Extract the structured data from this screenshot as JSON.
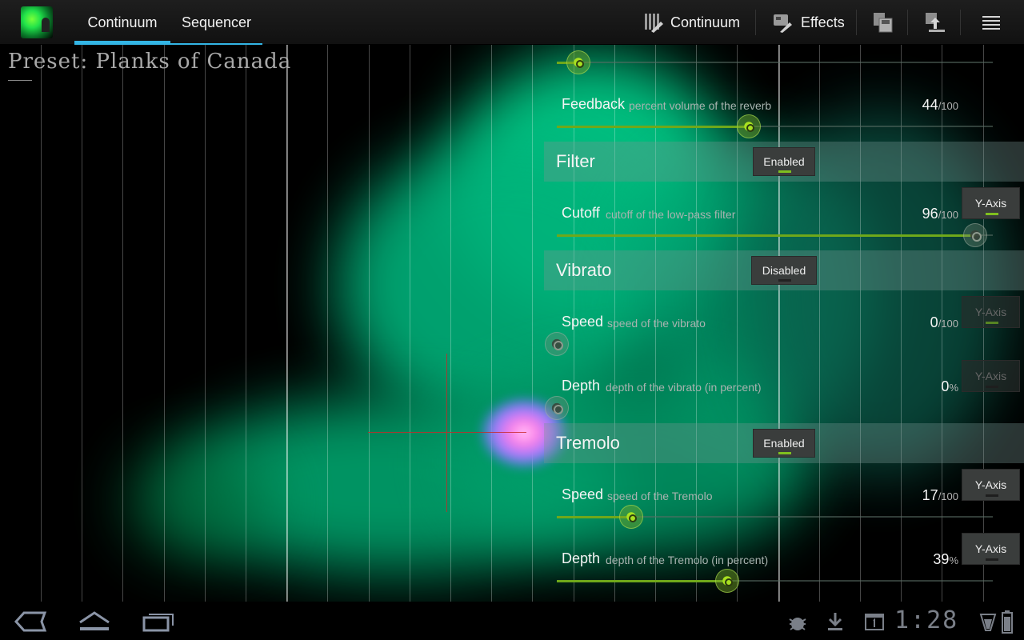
{
  "actionbar": {
    "tabs": [
      {
        "label": "Continuum",
        "selected": true
      },
      {
        "label": "Sequencer",
        "selected": false
      }
    ],
    "actions": {
      "continuum_label": "Continuum",
      "effects_label": "Effects"
    },
    "accent_color": "#33b5e5"
  },
  "field": {
    "preset_label": "Preset: Planks of Canada",
    "blob_color": "#00c986",
    "touch_color": "#ff7fe6",
    "crosshair_color": "#c82828"
  },
  "panel": {
    "reverb_partial": {
      "value_fraction": 0.05
    },
    "feedback": {
      "name": "Feedback",
      "desc": "percent volume of the reverb",
      "value": "44",
      "unit": "/100",
      "value_fraction": 0.44
    },
    "filter": {
      "title": "Filter",
      "toggle_label": "Enabled",
      "enabled": true,
      "cutoff": {
        "name": "Cutoff",
        "desc": "cutoff of the low-pass filter",
        "value": "96",
        "unit": "/100",
        "value_fraction": 0.96,
        "yaxis_label": "Y-Axis",
        "yaxis_active": true
      }
    },
    "vibrato": {
      "title": "Vibrato",
      "toggle_label": "Disabled",
      "enabled": false,
      "speed": {
        "name": "Speed",
        "desc": "speed of the vibrato",
        "value": "0",
        "unit": "/100",
        "value_fraction": 0.0,
        "yaxis_label": "Y-Axis"
      },
      "depth": {
        "name": "Depth",
        "desc": "depth of the vibrato (in percent)",
        "value": "0",
        "unit": "%",
        "value_fraction": 0.0,
        "yaxis_label": "Y-Axis"
      }
    },
    "tremolo": {
      "title": "Tremolo",
      "toggle_label": "Enabled",
      "enabled": true,
      "speed": {
        "name": "Speed",
        "desc": "speed of the Tremolo",
        "value": "17",
        "unit": "/100",
        "value_fraction": 0.17,
        "yaxis_label": "Y-Axis",
        "yaxis_active": false
      },
      "depth": {
        "name": "Depth",
        "desc": "depth of the Tremolo (in percent)",
        "value": "39",
        "unit": "%",
        "value_fraction": 0.39,
        "yaxis_label": "Y-Axis",
        "yaxis_active": false
      }
    },
    "slider_color": "#6fa81a"
  },
  "sysbar": {
    "clock": "1:28",
    "icon_color": "#7a7f88"
  }
}
